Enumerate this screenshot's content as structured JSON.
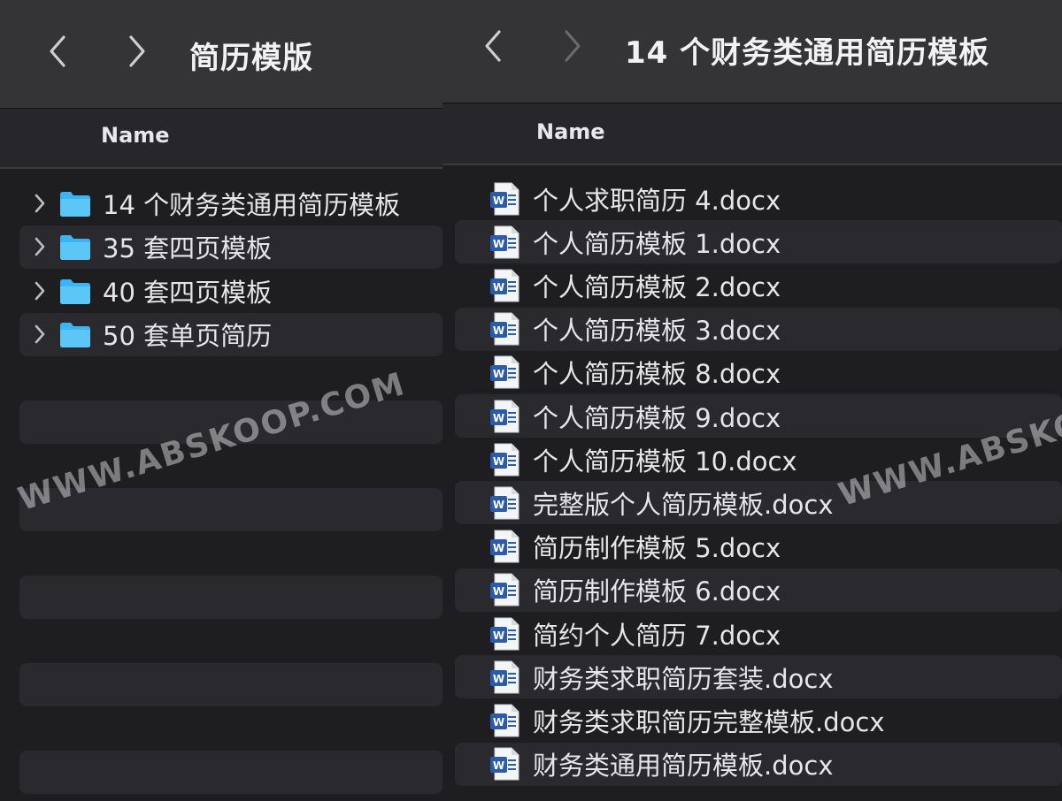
{
  "left_pane": {
    "title": "简历模版",
    "column_header": "Name",
    "items": [
      {
        "label": "14 个财务类通用简历模板"
      },
      {
        "label": "35 套四页模板"
      },
      {
        "label": "40 套四页模板"
      },
      {
        "label": "50 套单页简历"
      }
    ]
  },
  "right_pane": {
    "title": "14 个财务类通用简历模板",
    "column_header": "Name",
    "files": [
      {
        "label": "个人求职简历 4.docx"
      },
      {
        "label": "个人简历模板 1.docx"
      },
      {
        "label": "个人简历模板 2.docx"
      },
      {
        "label": "个人简历模板 3.docx"
      },
      {
        "label": "个人简历模板 8.docx"
      },
      {
        "label": "个人简历模板 9.docx"
      },
      {
        "label": "个人简历模板 10.docx"
      },
      {
        "label": "完整版个人简历模板.docx"
      },
      {
        "label": "简历制作模板 5.docx"
      },
      {
        "label": "简历制作模板 6.docx"
      },
      {
        "label": "简约个人简历 7.docx"
      },
      {
        "label": "财务类求职简历套装.docx"
      },
      {
        "label": "财务类求职简历完整模板.docx"
      },
      {
        "label": "财务类通用简历模板.docx"
      }
    ]
  },
  "icons": {
    "back": "chevron-left-icon",
    "forward": "chevron-right-icon",
    "disclosure": "chevron-right-icon",
    "folder": "folder-icon",
    "document": "word-document-icon"
  },
  "colors": {
    "folder_blue": "#3ab4f2",
    "word_blue": "#2a5cab"
  },
  "watermarks": [
    {
      "text": "WWW.ABSKOOP.COM"
    },
    {
      "text": "WWW.ABSKO"
    }
  ]
}
